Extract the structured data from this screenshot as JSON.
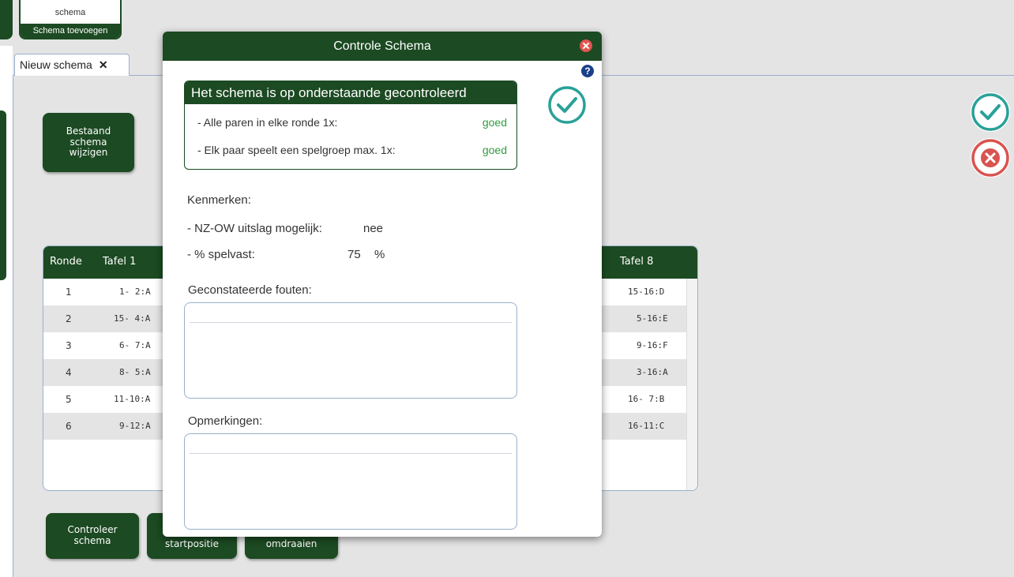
{
  "toolbar": {
    "schema_word": "schema",
    "add_schema_label": "Schema toevoegen"
  },
  "tab": {
    "label": "Nieuw schema",
    "close_glyph": "✕"
  },
  "buttons": {
    "edit_existing": [
      "Bestaand",
      "schema",
      "wijzigen"
    ],
    "check_schema": [
      "Controleer",
      "schema"
    ],
    "start_position": "startpositie",
    "flip": "omdraaien"
  },
  "schedule": {
    "headers": {
      "round": "Ronde",
      "table1": "Tafel 1",
      "table8": "Tafel 8"
    },
    "rows": [
      {
        "round": "1",
        "t1": "1- 2:A",
        "t8": "15-16:D"
      },
      {
        "round": "2",
        "t1": "15- 4:A",
        "t8": "5-16:E"
      },
      {
        "round": "3",
        "t1": "6- 7:A",
        "t8": "9-16:F"
      },
      {
        "round": "4",
        "t1": "8- 5:A",
        "t8": "3-16:A"
      },
      {
        "round": "5",
        "t1": "11-10:A",
        "t8": "16- 7:B"
      },
      {
        "round": "6",
        "t1": "9-12:A",
        "t8": "16-11:C"
      }
    ]
  },
  "dialog": {
    "title": "Controle Schema",
    "help_glyph": "?",
    "check_header": "Het schema is op onderstaande gecontroleerd",
    "checks": [
      {
        "label": "- Alle paren in elke ronde 1x:",
        "value": "goed"
      },
      {
        "label": "- Elk paar speelt een spelgroep max. 1x:",
        "value": "goed"
      }
    ],
    "features_label": "Kenmerken:",
    "nzow_label": "- NZ-OW uitslag mogelijk:",
    "nzow_value": "nee",
    "fixed_label": "- % spelvast:",
    "fixed_value": "75",
    "fixed_unit": "%",
    "errors_label": "Geconstateerde fouten:",
    "remarks_label": "Opmerkingen:"
  },
  "colors": {
    "brand_green": "#1c4a22",
    "ok_teal": "#2aa198",
    "cancel_red": "#d9534f",
    "good_text": "#2e9e3e"
  },
  "icons": {
    "dialog_ok": "check-circle-icon",
    "confirm": "check-circle-icon",
    "cancel": "x-circle-icon"
  }
}
